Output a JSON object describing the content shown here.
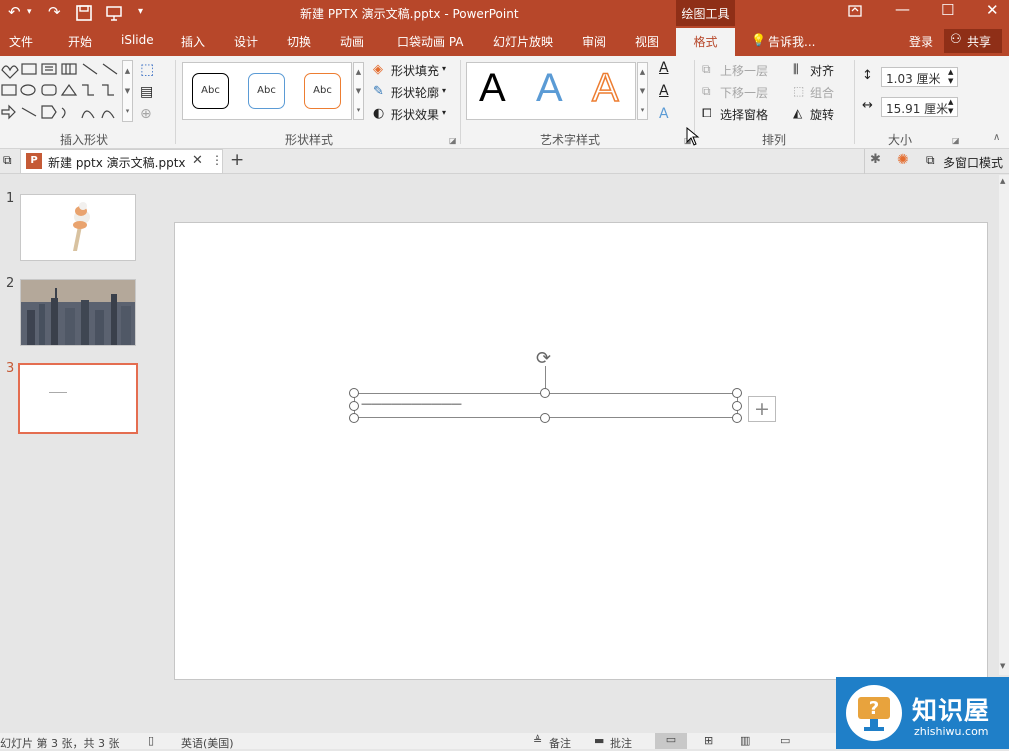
{
  "window": {
    "title": "新建 PPTX 演示文稿.pptx - PowerPoint",
    "context_tab": "绘图工具",
    "controls": [
      "restore-ribbon-icon",
      "minimize-icon",
      "maximize-icon",
      "close-icon"
    ]
  },
  "tabs": [
    "文件",
    "开始",
    "iSlide",
    "插入",
    "设计",
    "切换",
    "动画",
    "口袋动画 PA",
    "幻灯片放映",
    "审阅",
    "视图",
    "格式"
  ],
  "tell_me": "告诉我...",
  "login": "登录",
  "share": "共享",
  "ribbon": {
    "groups": {
      "insert_shapes": "插入形状",
      "shape_styles": "形状样式",
      "wordart_styles": "艺术字样式",
      "arrange": "排列",
      "size": "大小"
    },
    "shape_style_samples": [
      "Abc",
      "Abc",
      "Abc"
    ],
    "shape_fill": "形状填充",
    "shape_outline": "形状轮廓",
    "shape_effects": "形状效果",
    "wordart_sample": "A",
    "bring_forward": "上移一层",
    "send_backward": "下移一层",
    "selection_pane": "选择窗格",
    "align": "对齐",
    "group": "组合",
    "rotate": "旋转",
    "height": "1.03 厘米",
    "width": "15.91 厘米",
    "colors": {
      "style1": "#000000",
      "style2": "#5b9bd5",
      "style3": "#ed7d31"
    }
  },
  "doc_tab": {
    "name": "新建 pptx 演示文稿.pptx",
    "add": "+",
    "multi_window": "多窗口模式"
  },
  "thumbnails": [
    {
      "num": "1"
    },
    {
      "num": "2"
    },
    {
      "num": "3"
    }
  ],
  "slide": {
    "text": "——————————"
  },
  "status": {
    "slide_info": "幻灯片 第 3 张，共 3 张",
    "language": "英语(美国)",
    "notes": "备注",
    "comments": "批注"
  },
  "watermark": {
    "title": "知识屋",
    "url": "zhishiwu.com"
  }
}
